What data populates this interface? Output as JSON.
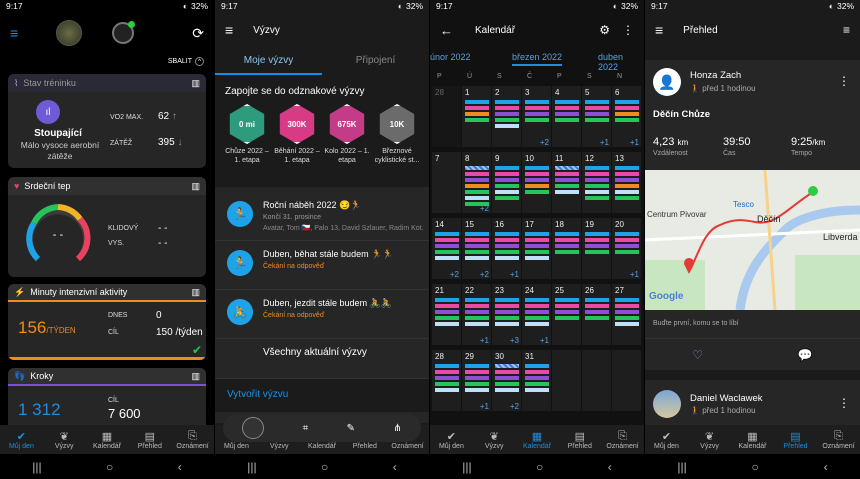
{
  "status": {
    "time": "9:17",
    "battery": "32%"
  },
  "nav": [
    {
      "label": "Můj den"
    },
    {
      "label": "Výzvy"
    },
    {
      "label": "Kalendář"
    },
    {
      "label": "Přehled"
    },
    {
      "label": "Oznámení"
    }
  ],
  "myday": {
    "collapse": "SBALIT",
    "training": {
      "title": "Stav tréninku",
      "state": "Stoupající",
      "desc": "Málo vysoce aerobní zátěže",
      "vo2_label": "VO2 MAX.",
      "vo2": "62",
      "load_label": "ZÁTĚŽ",
      "load": "395"
    },
    "heart": {
      "title": "Srdeční tep",
      "gauge": "- -",
      "rest_label": "KLIDOVÝ",
      "rest": "- -",
      "high_label": "VYS.",
      "high": "- -"
    },
    "intensity": {
      "title": "Minuty intenzivní aktivity",
      "value": "156",
      "unit": "/TÝDEN",
      "today_label": "DNES",
      "today": "0",
      "goal_label": "CÍL",
      "goal": "150 /týden",
      "progress": 1.04
    },
    "steps": {
      "title": "Kroky",
      "value": "1 312",
      "goal_label": "CÍL",
      "goal": "7 600",
      "progress": 0.17
    }
  },
  "challenges": {
    "title": "Výzvy",
    "tab1": "Moje výzvy",
    "tab2": "Připojení",
    "badges_title": "Zapojte se do odznakové výzvy",
    "badges": [
      {
        "name": "Chůze 2022 – 1. etapa",
        "icon": "0 mi"
      },
      {
        "name": "Běhání 2022 – 1. etapa",
        "icon": "300K"
      },
      {
        "name": "Kolo 2022 – 1. etapa",
        "icon": "675K"
      },
      {
        "name": "Březnové cyklistické st...",
        "icon": "10K"
      }
    ],
    "items": [
      {
        "name": "Roční náběh 2022 😏🏃",
        "sub": "Končí 31. prosince",
        "extra": "Avatar, Tom 🇨🇿, Palo 13, David Szlauer, Radim Kot..."
      },
      {
        "name": "Duben, běhat stále budem 🏃🏃",
        "sub": "Čekání na odpověď"
      },
      {
        "name": "Duben, jezdit stále budem 🚴🚴",
        "sub": "Čekání na odpověď"
      }
    ],
    "all": "Všechny aktuální výzvy",
    "create": "Vytvořit výzvu"
  },
  "calendar": {
    "title": "Kalendář",
    "prev": "únor 2022",
    "current": "březen 2022",
    "next": "duben 2022",
    "dow": [
      "P",
      "Ú",
      "S",
      "Č",
      "P",
      "S",
      "N"
    ],
    "weeks": [
      [
        {
          "d": "28"
        },
        {
          "d": "1",
          "b": [
            0,
            1,
            2,
            3
          ]
        },
        {
          "d": "2",
          "b": [
            0,
            1,
            4,
            3,
            5
          ]
        },
        {
          "d": "3",
          "b": [
            0,
            1,
            4,
            3
          ],
          "p": "+2"
        },
        {
          "d": "4",
          "b": [
            0,
            1,
            4,
            3
          ]
        },
        {
          "d": "5",
          "b": [
            0,
            1,
            4,
            3
          ],
          "p": "+1"
        },
        {
          "d": "6",
          "b": [
            0,
            1,
            2,
            3
          ],
          "p": "+1"
        }
      ],
      [
        {
          "d": "7"
        },
        {
          "d": "8",
          "b": [
            6,
            1,
            4,
            2,
            3,
            5,
            3
          ],
          "p": "+2"
        },
        {
          "d": "9",
          "b": [
            0,
            1,
            4,
            3,
            5,
            3
          ]
        },
        {
          "d": "10",
          "b": [
            0,
            1,
            4,
            2,
            3
          ]
        },
        {
          "d": "11",
          "b": [
            6,
            1,
            4,
            3,
            5
          ]
        },
        {
          "d": "12",
          "b": [
            0,
            1,
            4,
            3,
            5,
            3
          ]
        },
        {
          "d": "13",
          "b": [
            0,
            1,
            4,
            2,
            5,
            3
          ]
        }
      ],
      [
        {
          "d": "14",
          "b": [
            0,
            1,
            4,
            3,
            5
          ],
          "p": "+2"
        },
        {
          "d": "15",
          "b": [
            0,
            1,
            4,
            3,
            5
          ],
          "p": "+2"
        },
        {
          "d": "16",
          "b": [
            0,
            1,
            4,
            3,
            5
          ],
          "p": "+1"
        },
        {
          "d": "17",
          "b": [
            0,
            1,
            4,
            3,
            5
          ]
        },
        {
          "d": "18",
          "b": [
            0,
            1,
            4,
            3
          ]
        },
        {
          "d": "19",
          "b": [
            0,
            1,
            4,
            3
          ]
        },
        {
          "d": "20",
          "b": [
            0,
            1,
            4,
            3
          ],
          "p": "+1"
        }
      ],
      [
        {
          "d": "21",
          "b": [
            0,
            1,
            4,
            3,
            5
          ]
        },
        {
          "d": "22",
          "b": [
            0,
            1,
            4,
            3,
            5
          ],
          "p": "+1"
        },
        {
          "d": "23",
          "b": [
            0,
            1,
            4,
            3,
            5
          ],
          "p": "+3"
        },
        {
          "d": "24",
          "b": [
            0,
            1,
            4,
            3,
            5
          ],
          "p": "+1"
        },
        {
          "d": "25",
          "b": [
            0,
            1,
            4,
            3
          ]
        },
        {
          "d": "26",
          "b": [
            0,
            1,
            4,
            3
          ]
        },
        {
          "d": "27",
          "b": [
            0,
            1,
            4,
            3,
            5
          ]
        }
      ],
      [
        {
          "d": "28",
          "b": [
            0,
            1,
            4,
            3,
            5
          ]
        },
        {
          "d": "29",
          "b": [
            0,
            1,
            4,
            3,
            5
          ],
          "p": "+1"
        },
        {
          "d": "30",
          "b": [
            6,
            1,
            4,
            3,
            5
          ],
          "p": "+2"
        },
        {
          "d": "31",
          "b": [
            0,
            1,
            4,
            3,
            5
          ]
        },
        {
          "d": ""
        },
        {
          "d": ""
        },
        {
          "d": ""
        }
      ]
    ],
    "colors": [
      "#1fa3e8",
      "#e84aa8",
      "#f28a24",
      "#25c45c",
      "#8e4fd6",
      "#bfe0f7",
      "#3a7ad8"
    ]
  },
  "feed": {
    "title": "Přehled",
    "post1": {
      "name": "Honza Zach",
      "time": "před 1 hodinou",
      "activity": "Děčín Chůze",
      "dist": "4,23",
      "dist_unit": "km",
      "dist_label": "Vzdálenost",
      "duration": "39:50",
      "duration_label": "Čas",
      "pace": "9:25",
      "pace_unit": "/km",
      "pace_label": "Tempo",
      "first": "Buďte první, komu se to líbí"
    },
    "map": {
      "label1": "Centrum Pivovar",
      "label2": "Tesco",
      "label3": "Děčín",
      "label4": "Libverda",
      "brand": "Google"
    },
    "post2": {
      "name": "Daniel Waclawek",
      "time": "před 1 hodinou"
    }
  }
}
